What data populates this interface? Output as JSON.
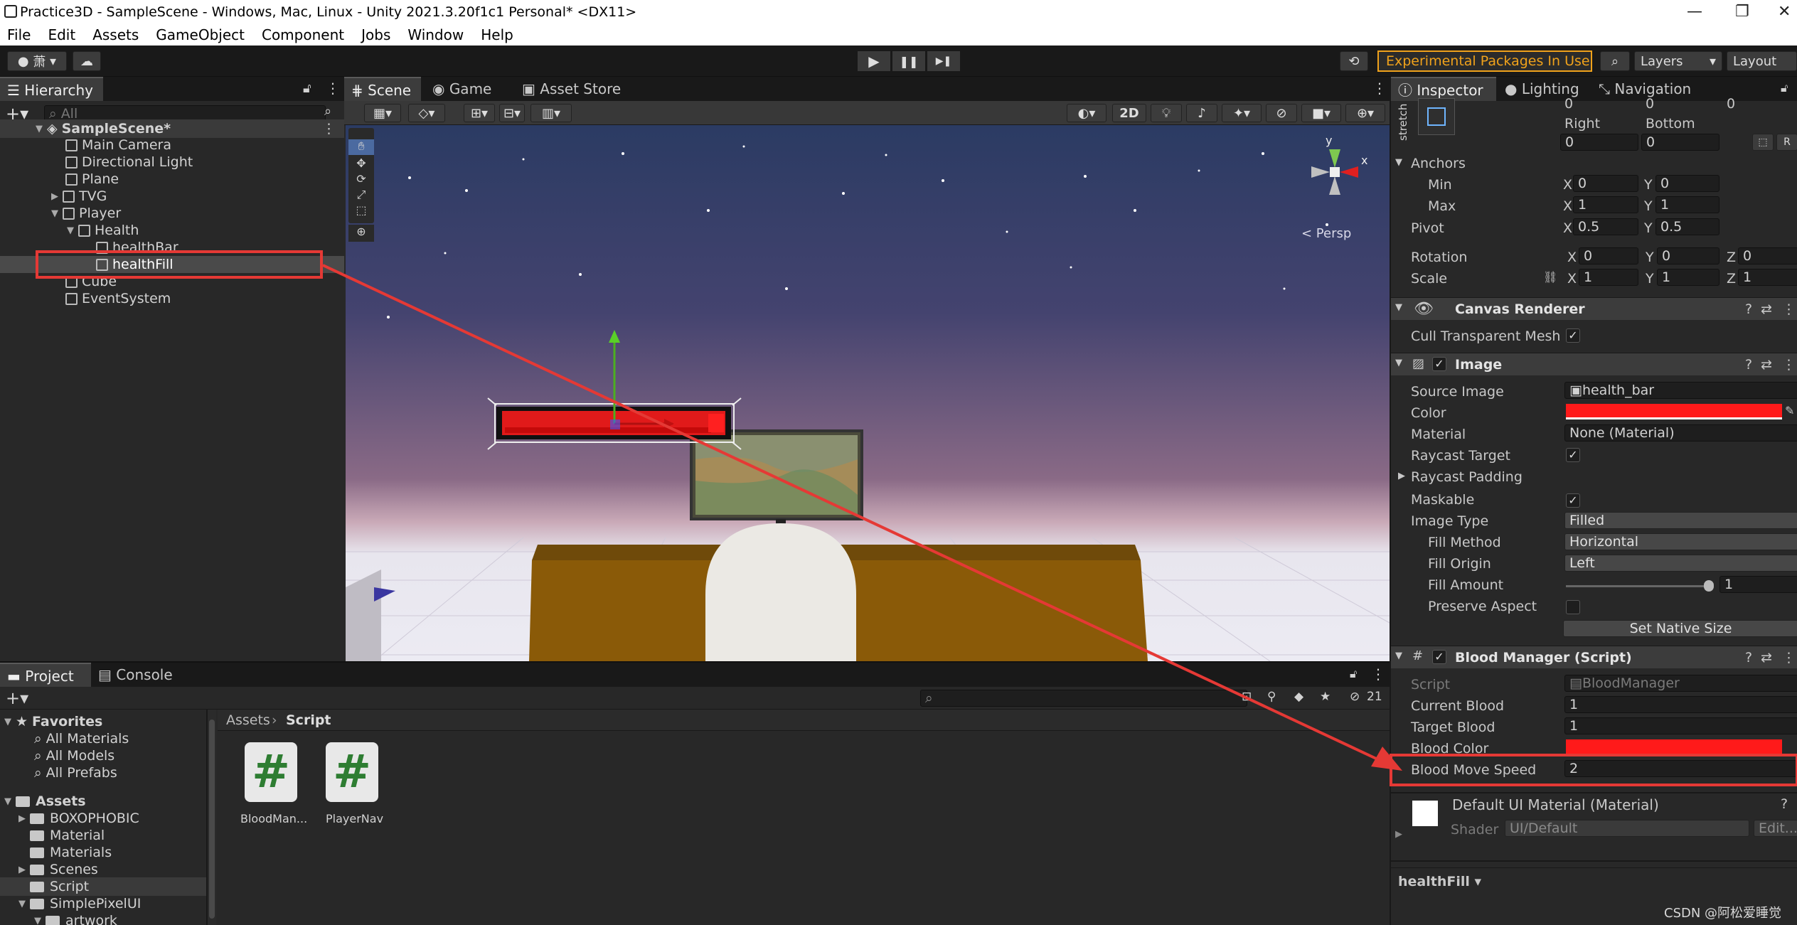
{
  "window": {
    "title": "Practice3D - SampleScene - Windows, Mac, Linux - Unity 2021.3.20f1c1 Personal* <DX11>",
    "controls": [
      "—",
      "❐",
      "✕"
    ]
  },
  "menu": [
    "File",
    "Edit",
    "Assets",
    "GameObject",
    "Component",
    "Jobs",
    "Window",
    "Help"
  ],
  "toolbar": {
    "account_label": "萧",
    "play": "▶",
    "pause": "❚❚",
    "step": "▶❚",
    "experimental_packages": "Experimental Packages In Use ▾",
    "layers": "Layers",
    "layout": "Layout"
  },
  "hierarchy": {
    "tab": "Hierarchy",
    "search_placeholder": "All",
    "scene": "SampleScene*",
    "items": [
      {
        "label": "Main Camera"
      },
      {
        "label": "Directional Light"
      },
      {
        "label": "Plane"
      },
      {
        "label": "TVG"
      },
      {
        "label": "Player"
      },
      {
        "label": "Health"
      },
      {
        "label": "healthBar"
      },
      {
        "label": "healthFill"
      },
      {
        "label": "Cube"
      },
      {
        "label": "EventSystem"
      }
    ]
  },
  "scene": {
    "tabs": [
      "Scene",
      "Game",
      "Asset Store"
    ],
    "toggle_2d": "2D",
    "persp": "< Persp",
    "axis_y": "y",
    "axis_x": "x"
  },
  "inspector": {
    "tabs": [
      "Inspector",
      "Lighting",
      "Navigation"
    ],
    "rect": {
      "stretch_label": "stretch",
      "top_values": [
        "0",
        "0",
        "0"
      ],
      "right_label": "Right",
      "bottom_label": "Bottom",
      "right": "0",
      "bottom": "0",
      "anchors_label": "Anchors",
      "min_label": "Min",
      "min_x": "0",
      "min_y": "0",
      "max_label": "Max",
      "max_x": "1",
      "max_y": "1",
      "pivot_label": "Pivot",
      "pivot_x": "0.5",
      "pivot_y": "0.5",
      "rotation_label": "Rotation",
      "rot_x": "0",
      "rot_y": "0",
      "rot_z": "0",
      "scale_label": "Scale",
      "scale_x": "1",
      "scale_y": "1",
      "scale_z": "1",
      "x": "X",
      "y": "Y",
      "z": "Z"
    },
    "canvas_renderer": {
      "title": "Canvas Renderer",
      "cull_label": "Cull Transparent Mesh"
    },
    "image": {
      "title": "Image",
      "source_image_label": "Source Image",
      "source_image": "health_bar",
      "color_label": "Color",
      "color": "#ff1a1a",
      "material_label": "Material",
      "material": "None (Material)",
      "raycast_target_label": "Raycast Target",
      "raycast_padding_label": "Raycast Padding",
      "maskable_label": "Maskable",
      "image_type_label": "Image Type",
      "image_type": "Filled",
      "fill_method_label": "Fill Method",
      "fill_method": "Horizontal",
      "fill_origin_label": "Fill Origin",
      "fill_origin": "Left",
      "fill_amount_label": "Fill Amount",
      "fill_amount": "1",
      "preserve_aspect_label": "Preserve Aspect",
      "set_native_size": "Set Native Size"
    },
    "blood_manager": {
      "title": "Blood Manager (Script)",
      "script_label": "Script",
      "script": "BloodManager",
      "current_blood_label": "Current Blood",
      "current_blood": "1",
      "target_blood_label": "Target Blood",
      "target_blood": "1",
      "blood_color_label": "Blood Color",
      "blood_color": "#ff1a1a",
      "blood_move_speed_label": "Blood Move Speed",
      "blood_move_speed": "2"
    },
    "material": {
      "title": "Default UI Material (Material)",
      "shader_label": "Shader",
      "shader": "UI/Default",
      "edit": "Edit..."
    },
    "footer": "healthFill ▾"
  },
  "project": {
    "tabs": [
      "Project",
      "Console"
    ],
    "hidden_count": "21",
    "favorites_label": "Favorites",
    "favorites": [
      "All Materials",
      "All Models",
      "All Prefabs"
    ],
    "assets_label": "Assets",
    "folders": [
      "BOXOPHOBIC",
      "Material",
      "Materials",
      "Scenes",
      "Script",
      "SimplePixelUI",
      "artwork"
    ],
    "breadcrumb": [
      "Assets",
      "Script"
    ],
    "files": [
      {
        "name": "BloodMan..."
      },
      {
        "name": "PlayerNav"
      }
    ]
  },
  "watermark": "CSDN @阿松爱睡觉",
  "colors": {
    "annotation": "#e53935",
    "accent_orange": "#f0a21b",
    "health_red": "#ff1a1a"
  }
}
